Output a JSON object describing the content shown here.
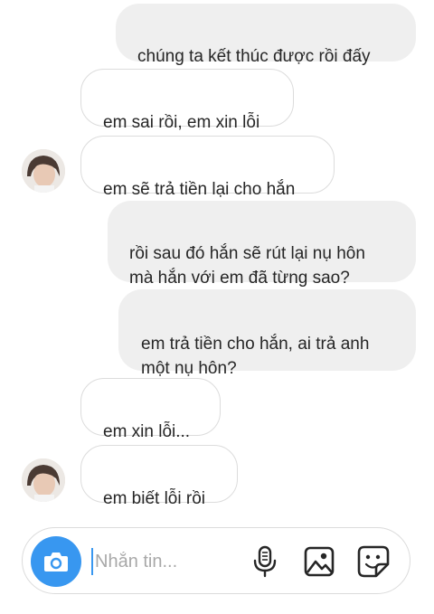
{
  "messages": [
    {
      "direction": "outgoing",
      "text": "chúng ta kết thúc được rồi đấy"
    },
    {
      "direction": "incoming",
      "text": "em sai rồi, em xin lỗi"
    },
    {
      "direction": "incoming",
      "text": "em sẽ trả tiền lại cho hắn"
    },
    {
      "direction": "outgoing",
      "text": "rồi sau đó hắn sẽ rút lại nụ hôn\nmà hắn với em đã từng sao?"
    },
    {
      "direction": "outgoing",
      "text": "em trả tiền cho hắn, ai trả anh\nmột nụ hôn?"
    },
    {
      "direction": "incoming",
      "text": "em xin lỗi..."
    },
    {
      "direction": "incoming",
      "text": "em biết lỗi rồi"
    }
  ],
  "composer": {
    "placeholder": "Nhắn tin...",
    "value": "",
    "accent_color": "#3897f0",
    "icons": [
      "camera-icon",
      "microphone-icon",
      "gallery-icon",
      "sticker-icon"
    ]
  }
}
